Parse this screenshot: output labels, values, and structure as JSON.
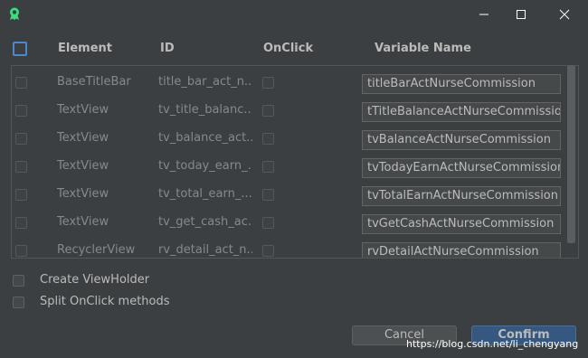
{
  "header": {
    "element": "Element",
    "id": "ID",
    "onclick": "OnClick",
    "variable_name": "Variable Name"
  },
  "rows": [
    {
      "element": "BaseTitleBar",
      "id": "title_bar_act_n...",
      "variable": "titleBarActNurseCommission"
    },
    {
      "element": "TextView",
      "id": "tv_title_balanc...",
      "variable": "tTitleBalanceActNurseCommission"
    },
    {
      "element": "TextView",
      "id": "tv_balance_act...",
      "variable": "tvBalanceActNurseCommission"
    },
    {
      "element": "TextView",
      "id": "tv_today_earn_...",
      "variable": "tvTodayEarnActNurseCommission"
    },
    {
      "element": "TextView",
      "id": "tv_total_earn_...",
      "variable": "tvTotalEarnActNurseCommission"
    },
    {
      "element": "TextView",
      "id": "tv_get_cash_ac...",
      "variable": "tvGetCashActNurseCommission"
    },
    {
      "element": "RecyclerView",
      "id": "rv_detail_act_n...",
      "variable": "rvDetailActNurseCommission"
    }
  ],
  "options": {
    "create_viewholder": "Create ViewHolder",
    "split_onclick": "Split OnClick methods"
  },
  "buttons": {
    "cancel": "Cancel",
    "confirm": "Confirm"
  },
  "watermark": "https://blog.csdn.net/li_chengyang",
  "icons": {
    "app": "android-plugin-icon",
    "minimize": "minimize-icon",
    "maximize": "maximize-icon",
    "close": "close-icon"
  },
  "colors": {
    "background": "#3c3f41",
    "accent": "#4a88c7",
    "confirm": "#365880",
    "app_icon": "#3ddc84"
  }
}
